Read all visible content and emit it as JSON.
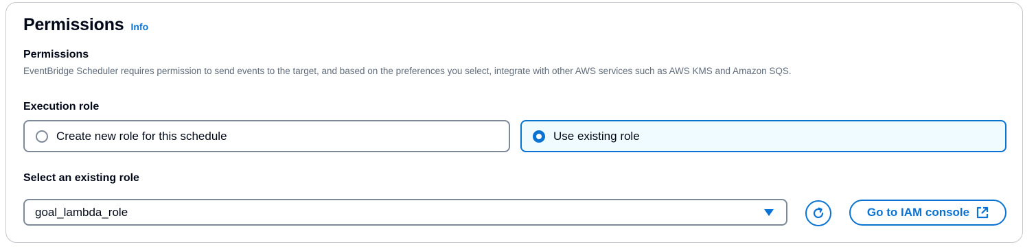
{
  "permissions_panel": {
    "title": "Permissions",
    "info_link": "Info",
    "section_label": "Permissions",
    "description": "EventBridge Scheduler requires permission to send events to the target, and based on the preferences you select, integrate with other AWS services such as AWS KMS and Amazon SQS.",
    "execution_role": {
      "label": "Execution role",
      "options": [
        {
          "label": "Create new role for this schedule",
          "selected": false
        },
        {
          "label": "Use existing role",
          "selected": true
        }
      ]
    },
    "existing_role": {
      "label": "Select an existing role",
      "selected_value": "goal_lambda_role"
    },
    "iam_button_label": "Go to IAM console",
    "icons": {
      "refresh": "refresh-icon",
      "external_link": "external-link-icon",
      "dropdown": "caret-down-icon"
    },
    "colors": {
      "accent": "#0972d3",
      "selected_tile_bg": "#f0fbff",
      "text": "#000716",
      "muted_text": "#5f6b7a",
      "border": "#7d8998"
    }
  }
}
